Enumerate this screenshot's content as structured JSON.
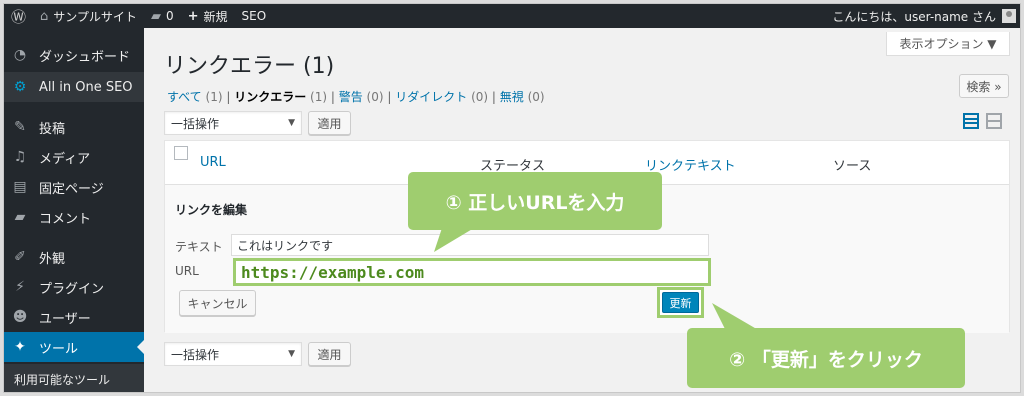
{
  "adminbar": {
    "site_name": "サンプルサイト",
    "comments_count": "0",
    "new_label": "新規",
    "seo_label": "SEO",
    "greeting": "こんにちは、user-name さん"
  },
  "sidebar": {
    "items": [
      {
        "label": "ダッシュボード",
        "icon": "dashboard-icon"
      },
      {
        "label": "All in One SEO",
        "icon": "gear-icon"
      },
      {
        "label": "投稿",
        "icon": "pin-icon"
      },
      {
        "label": "メディア",
        "icon": "media-icon"
      },
      {
        "label": "固定ページ",
        "icon": "page-icon"
      },
      {
        "label": "コメント",
        "icon": "comment-icon"
      },
      {
        "label": "外観",
        "icon": "brush-icon"
      },
      {
        "label": "プラグイン",
        "icon": "plugin-icon"
      },
      {
        "label": "ユーザー",
        "icon": "user-icon"
      },
      {
        "label": "ツール",
        "icon": "wrench-icon"
      }
    ],
    "submenu_label": "利用可能なツール"
  },
  "page": {
    "screen_options": "表示オプション ▼",
    "title": "リンクエラー (1)",
    "filters": {
      "all_label": "すべて",
      "all_count": "(1)",
      "broken_label": "リンクエラー",
      "broken_count": "(1)",
      "warning_label": "警告",
      "warning_count": "(0)",
      "redirect_label": "リダイレクト",
      "redirect_count": "(0)",
      "ignored_label": "無視",
      "ignored_count": "(0)"
    },
    "search_button": "検索 »",
    "bulk_action": "一括操作",
    "apply_button": "適用"
  },
  "table": {
    "headers": {
      "url": "URL",
      "status": "ステータス",
      "link_text": "リンクテキスト",
      "source": "ソース"
    },
    "edit": {
      "title": "リンクを編集",
      "text_label": "テキスト",
      "text_value": "これはリンクです",
      "url_label": "URL",
      "url_value": "https://example.com",
      "cancel_button": "キャンセル",
      "update_button": "更新"
    }
  },
  "callouts": {
    "step1": "① 正しいURLを入力",
    "step2": "② 「更新」をクリック"
  },
  "colors": {
    "callout_green": "#9fcd6f",
    "admin_dark": "#23282d",
    "accent_blue": "#0073aa"
  }
}
